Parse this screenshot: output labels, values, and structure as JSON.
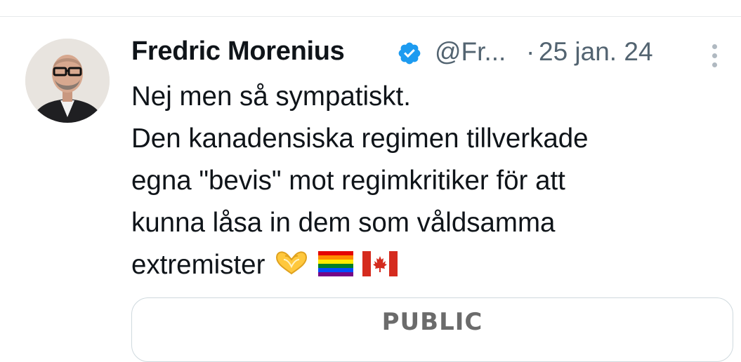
{
  "tweet": {
    "author_name": "Fredric Morenius",
    "handle": "@Fr...",
    "separator": "·",
    "date": "25 jan. 24",
    "text_lines": [
      "Nej men så sympatiskt.",
      "Den kanadensiska regimen tillverkade",
      "egna \"bevis\" mot regimkritiker för att",
      "kunna låsa in dem som våldsamma",
      "extremister"
    ],
    "emojis": [
      "heart-hands-icon",
      "rainbow-flag-icon",
      "canada-flag-icon"
    ]
  },
  "card": {
    "title": "PUBLIC"
  },
  "colors": {
    "text": "#0f1419",
    "secondary": "#536471",
    "verified": "#1d9bf0",
    "border": "#cfd9de"
  }
}
